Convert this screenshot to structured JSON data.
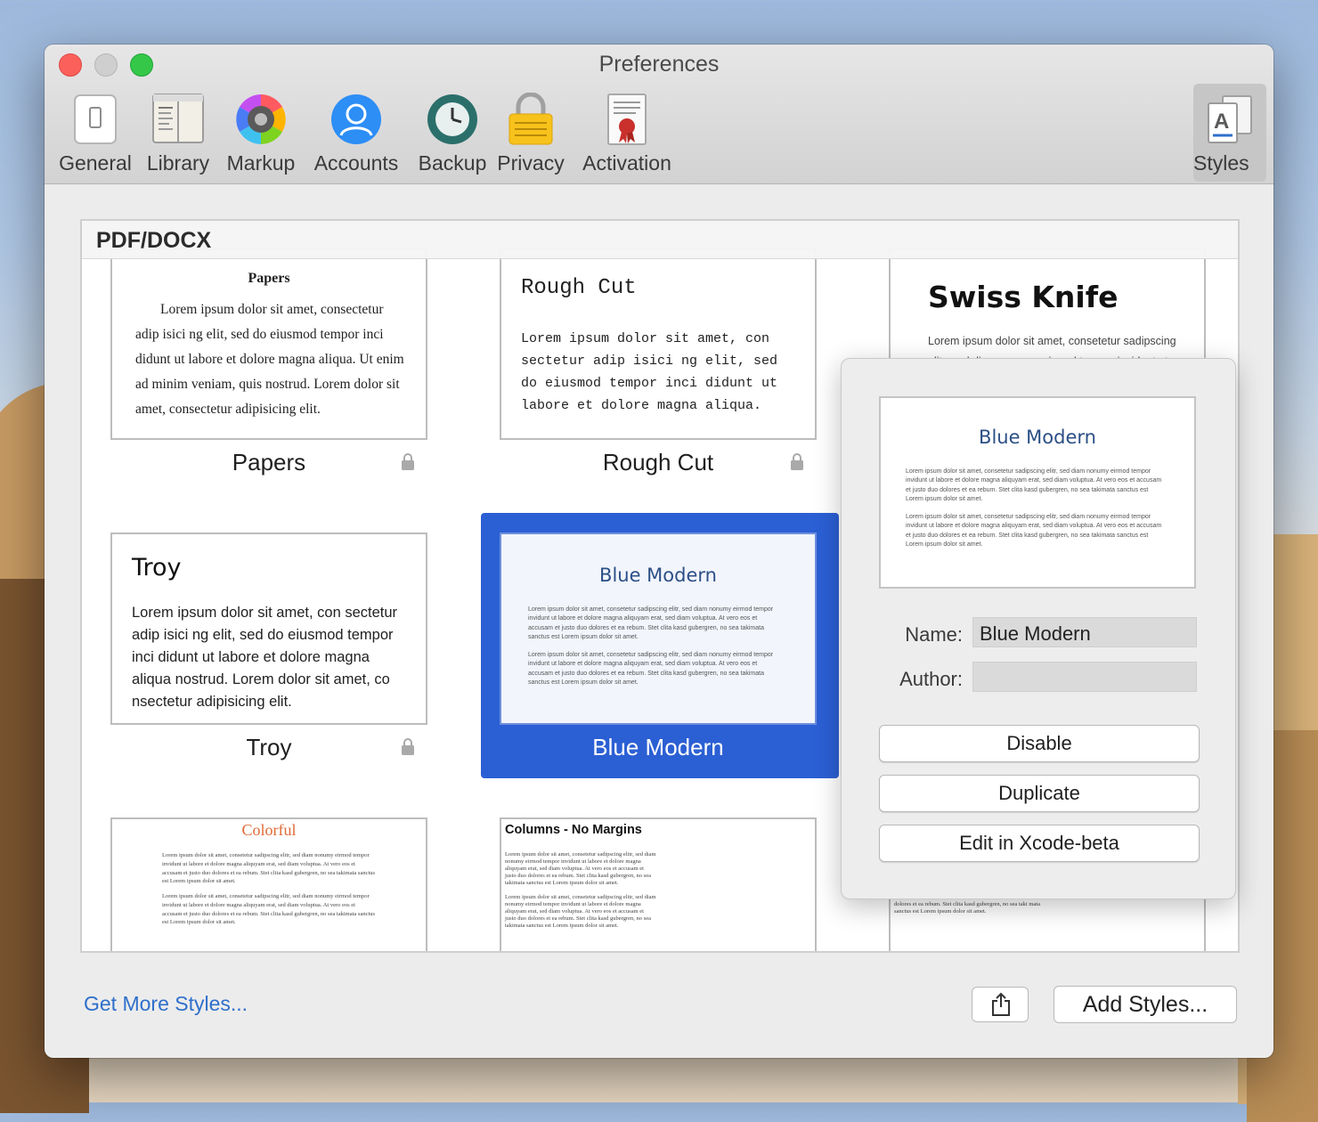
{
  "window": {
    "title": "Preferences"
  },
  "toolbar": {
    "items": [
      {
        "label": "General",
        "icon": "general-icon"
      },
      {
        "label": "Library",
        "icon": "library-icon"
      },
      {
        "label": "Markup",
        "icon": "markup-icon"
      },
      {
        "label": "Accounts",
        "icon": "accounts-icon"
      },
      {
        "label": "Backup",
        "icon": "backup-icon"
      },
      {
        "label": "Privacy",
        "icon": "privacy-lock-icon"
      },
      {
        "label": "Activation",
        "icon": "activation-certificate-icon"
      },
      {
        "label": "Styles",
        "icon": "styles-icon",
        "selected": true
      }
    ]
  },
  "section": {
    "title": "PDF/DOCX"
  },
  "styles": [
    {
      "name": "Papers",
      "locked": true,
      "preview_title": "Papers",
      "preview_body": "Lorem ipsum dolor sit amet, consectetur adip isici ng elit, sed do eiusmod tempor inci didunt ut labore  et dolore magna aliqua. Ut enim ad minim veniam, quis nostrud. Lorem dolor sit amet, consectetur adipisicing elit."
    },
    {
      "name": "Rough Cut",
      "locked": true,
      "preview_title": "Rough Cut",
      "preview_body": "Lorem ipsum dolor sit amet, con sectetur adip isici ng elit, sed do eiusmod tempor inci didunt ut labore et dolore magna aliqua."
    },
    {
      "name": "Swiss Knife",
      "locked": false,
      "preview_title": "Swiss Knife",
      "preview_body": "Lorem ipsum dolor sit amet, consetetur sadipscing elitr, sed diam nonumy eirmod tempor invidunt ut"
    },
    {
      "name": "Troy",
      "locked": true,
      "preview_title": "Troy",
      "preview_body": "Lorem ipsum dolor sit amet, con sectetur adip isici ng elit, sed do eiusmod tempor inci didunt ut labore et dolore magna aliqua nostrud. Lorem dolor sit amet, co nsectetur adipisicing elit."
    },
    {
      "name": "Blue Modern",
      "locked": false,
      "selected": true,
      "preview_title": "Blue Modern",
      "preview_para1": "Lorem ipsum dolor sit amet, consetetur sadipscing elitr, sed diam nonumy eirmod tempor invidunt ut labore et dolore magna aliquyam erat, sed diam voluptua. At vero eos et accusam et justo duo dolores et ea rebum. Stet clita kasd gubergren, no sea takimata sanctus est Lorem ipsum dolor sit amet.",
      "preview_para2": "Lorem ipsum dolor sit amet, consetetur sadipscing elitr, sed diam nonumy eirmod tempor invidunt ut labore et dolore magna aliquyam erat, sed diam voluptua. At vero eos et accusam et justo duo dolores et ea rebum. Stet clita kasd gubergren, no sea takimata sanctus est Lorem ipsum dolor sit amet."
    },
    {
      "name": "Colorful",
      "preview_title": "Colorful",
      "preview_para1": "Lorem ipsum dolor sit amet, consetetur sadipscing elitr, sed diam nonumy eirmod tempor invidunt ut labore et dolore magna aliquyam erat, sed diam voluptua. At vero eos et accusam et justo duo dolores et ea rebum. Stet clita kasd gubergren, no sea takimata sanctus est Lorem ipsum dolor sit amet.",
      "preview_para2": "Lorem ipsum dolor sit amet, consetetur sadipscing elitr, sed diam nonumy eirmod tempor invidunt ut labore et dolore magna aliquyam erat, sed diam voluptua. At vero eos et accusam et justo duo dolores et ea rebum. Stet clita kasd gubergren, no sea takimata sanctus est Lorem ipsum dolor sit amet."
    },
    {
      "name": "Columns - No Margins",
      "preview_title": "Columns - No Margins",
      "preview_para1": "Lorem ipsum dolor sit amet, consetetur sadipscing elitr, sed diam nonumy eirmod tempor invidunt ut labore et dolore magna aliquyam erat, sed diam voluptua. At vero eos et accusam et justo duo dolores et ea rebum. Stet clita kasd gubergren, no sea takimata sanctus est Lorem ipsum dolor sit amet.",
      "preview_para2": "Lorem ipsum dolor sit amet, consetetur sadipscing elitr, sed diam nonumy eirmod tempor invidunt ut labore et dolore magna aliquyam erat, sed diam voluptua. At vero eos et accusam et justo duo dolores et ea rebum. Stet clita kasd gubergren, no sea takimata sanctus est Lorem ipsum dolor sit amet."
    },
    {
      "preview_body": "dolores et ea rebum. Stet clita kasd gubergren, no sea taki mata sanctus est Lorem ipsum dolor sit amet."
    }
  ],
  "popover": {
    "preview_title": "Blue Modern",
    "preview_para1": "Lorem ipsum dolor sit amet, consetetur sadipscing elitr, sed diam nonumy eirmod tempor invidunt ut labore et dolore magna aliquyam erat, sed diam voluptua. At vero eos et accusam et justo duo dolores et ea rebum. Stet clita kasd gubergren, no sea takimata sanctus est Lorem ipsum dolor sit amet.",
    "preview_para2": "Lorem ipsum dolor sit amet, consetetur sadipscing elitr, sed diam nonumy eirmod tempor invidunt ut labore et dolore magna aliquyam erat, sed diam voluptua. At vero eos et accusam et justo duo dolores et ea rebum. Stet clita kasd gubergren, no sea takimata sanctus est Lorem ipsum dolor sit amet.",
    "name_label": "Name:",
    "name_value": "Blue Modern",
    "author_label": "Author:",
    "author_value": "",
    "buttons": [
      "Disable",
      "Duplicate",
      "Edit in Xcode-beta"
    ]
  },
  "footer": {
    "get_more_link": "Get More Styles...",
    "share_icon": "share-icon",
    "add_button": "Add Styles..."
  },
  "colors": {
    "selection": "#2b5fd4",
    "blue_modern_title": "#2c4f86",
    "colorful_title": "#e06a36",
    "link": "#2f6fcb"
  }
}
